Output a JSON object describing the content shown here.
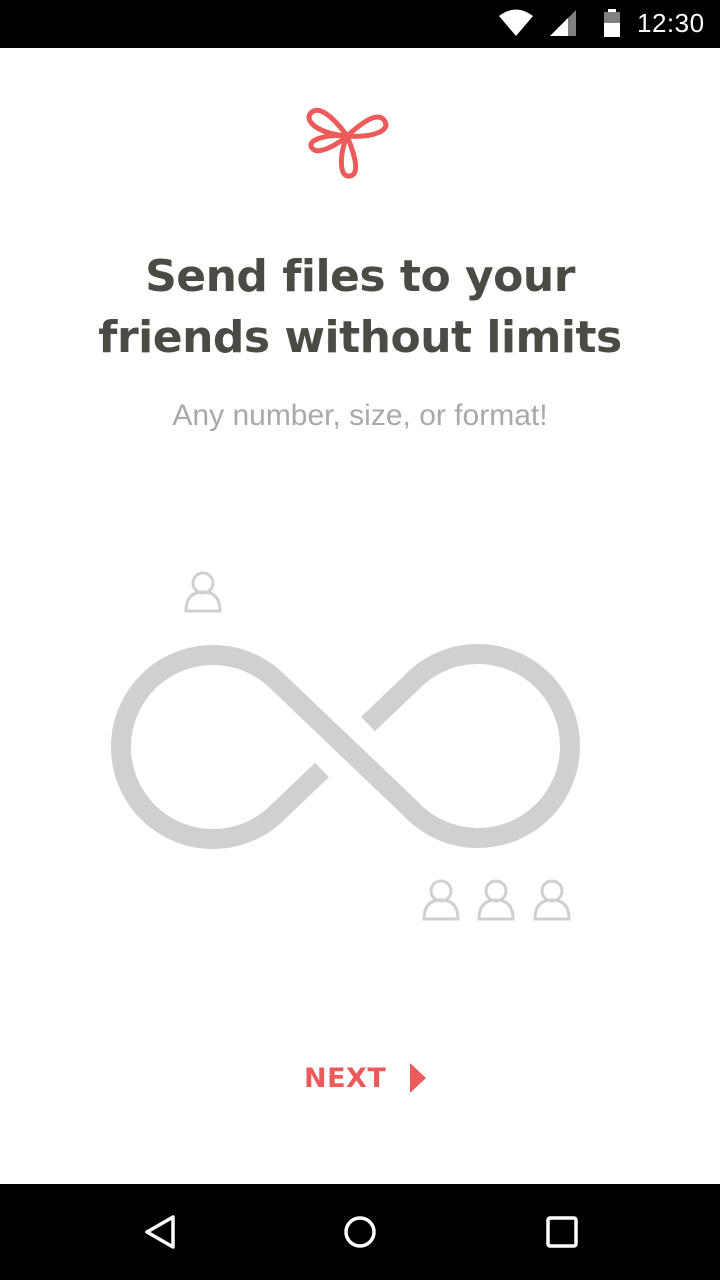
{
  "status_bar": {
    "time": "12:30",
    "icons": [
      "wifi-icon",
      "cell-signal-icon",
      "battery-icon"
    ]
  },
  "brand": {
    "logo_icon": "knot-logo-icon",
    "accent_color": "#ec5a5a"
  },
  "onboarding": {
    "title_line_1": "Send files to your",
    "title_line_2": "friends without limits",
    "subtitle": "Any number, size, or format!",
    "illustration": {
      "icons": [
        "infinity-icon",
        "person-icon",
        "person-icon",
        "person-icon",
        "person-icon"
      ],
      "color": "#d0d0d0"
    },
    "next_label": "NEXT"
  },
  "navigation_bar": {
    "buttons": [
      "back-icon",
      "home-icon",
      "recents-icon"
    ]
  }
}
